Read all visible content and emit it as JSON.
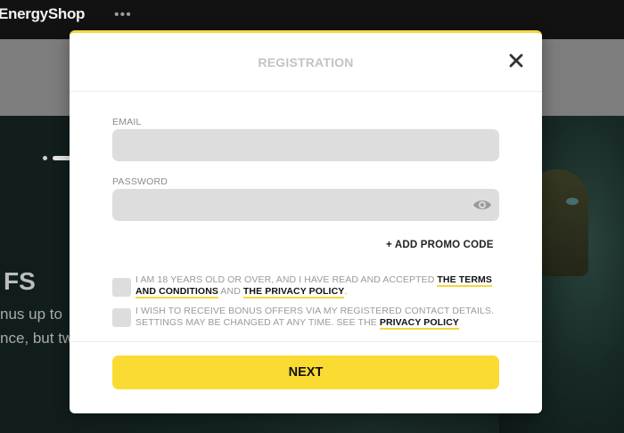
{
  "site": {
    "logo": "EnergyShop",
    "menu_dots": "•••",
    "hero_title": "FS",
    "hero_line1": "nus up to",
    "hero_line2": "nce, but tw"
  },
  "modal": {
    "title": "REGISTRATION",
    "email": {
      "label": "EMAIL",
      "value": "",
      "placeholder": ""
    },
    "password": {
      "label": "PASSWORD",
      "value": "",
      "placeholder": ""
    },
    "promo_label": "+ ADD PROMO CODE",
    "consent_age": {
      "text_before": "I AM 18 YEARS OLD OR OVER, AND I HAVE READ AND ACCEPTED ",
      "terms_link": "THE TERMS AND CONDITIONS",
      "and": " AND ",
      "privacy_link": "THE PRIVACY POLICY",
      "end": "."
    },
    "consent_bonus": {
      "text": "I WISH TO RECEIVE BONUS OFFERS VIA MY REGISTERED CONTACT DETAILS. SETTINGS MAY BE CHANGED AT ANY TIME. SEE THE ",
      "privacy_link": "PRIVACY POLICY",
      "end": ""
    },
    "next_label": "NEXT"
  },
  "colors": {
    "accent": "#fadb32",
    "field_bg": "#dddddd",
    "title": "#c3c3c3"
  },
  "icons": {
    "close": "close-icon",
    "eye": "eye-icon"
  }
}
